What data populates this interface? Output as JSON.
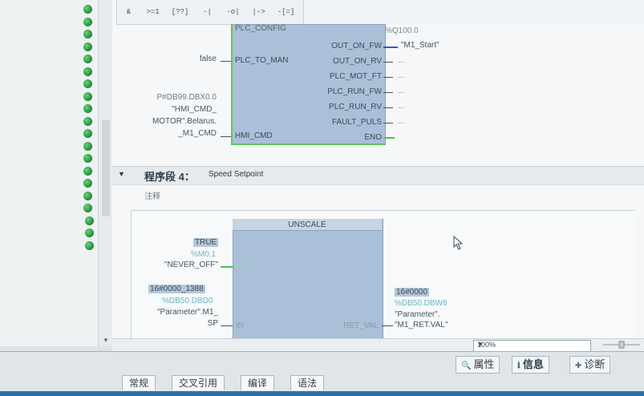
{
  "toolbar": {
    "buttons": [
      "&",
      ">=1",
      "[??]",
      "-|",
      "-o|",
      "|->",
      "-[=]"
    ]
  },
  "network3": {
    "block_label_top": "PLC_CONFIG",
    "top_addr": "%Q100.0",
    "inputs": [
      "PLC_TO_MAN",
      "HMI_CMD"
    ],
    "input_values": {
      "plc_to_man": "false",
      "hmi_cmd_1": "P#DB99.DBX0.0",
      "hmi_cmd_2": "\"HMI_CMD_",
      "hmi_cmd_3": "MOTOR\".Belarus.",
      "hmi_cmd_4": "_M1_CMD"
    },
    "outputs": [
      "OUT_ON_FW",
      "OUT_ON_RV",
      "PLC_MOT_FT",
      "PLC_RUN_FW",
      "PLC_RUN_RV",
      "FAULT_PULS",
      "ENO"
    ],
    "out_on_fw_value": "\"M1_Start\"",
    "ellipsis": "..."
  },
  "network4": {
    "title": "程序段 4：",
    "description": "Speed Setpoint",
    "comment": "注释",
    "block_name": "UNSCALE",
    "en_pin": "EN",
    "in_pin": "IN",
    "ret_val_pin": "RET_VAL",
    "en_value": "TRUE",
    "en_addr": "%M0.1",
    "en_name": "\"NEVER_OFF\"",
    "in_value": "16#0000_1388",
    "in_addr": "%DB50.DBD0",
    "in_name_1": "\"Parameter\".M1_",
    "in_name_2": "SP",
    "out_value": "16#0000",
    "out_addr": "%DB50.DBW8",
    "out_name_1": "\"Parameter\".",
    "out_name_2": "\"M1_RET.VAL\""
  },
  "statusbar": {
    "zoom": "100%"
  },
  "inspector": {
    "tabs": [
      "属性",
      "信息",
      "诊断"
    ],
    "bottom_tabs": [
      "常规",
      "交叉引用",
      "编译",
      "语法"
    ]
  },
  "colors": {
    "block_fill": "#a9c0d8",
    "status_ok": "#1d8a33",
    "wire_active": "#4fbf55",
    "wire_link": "#3b56c7"
  }
}
